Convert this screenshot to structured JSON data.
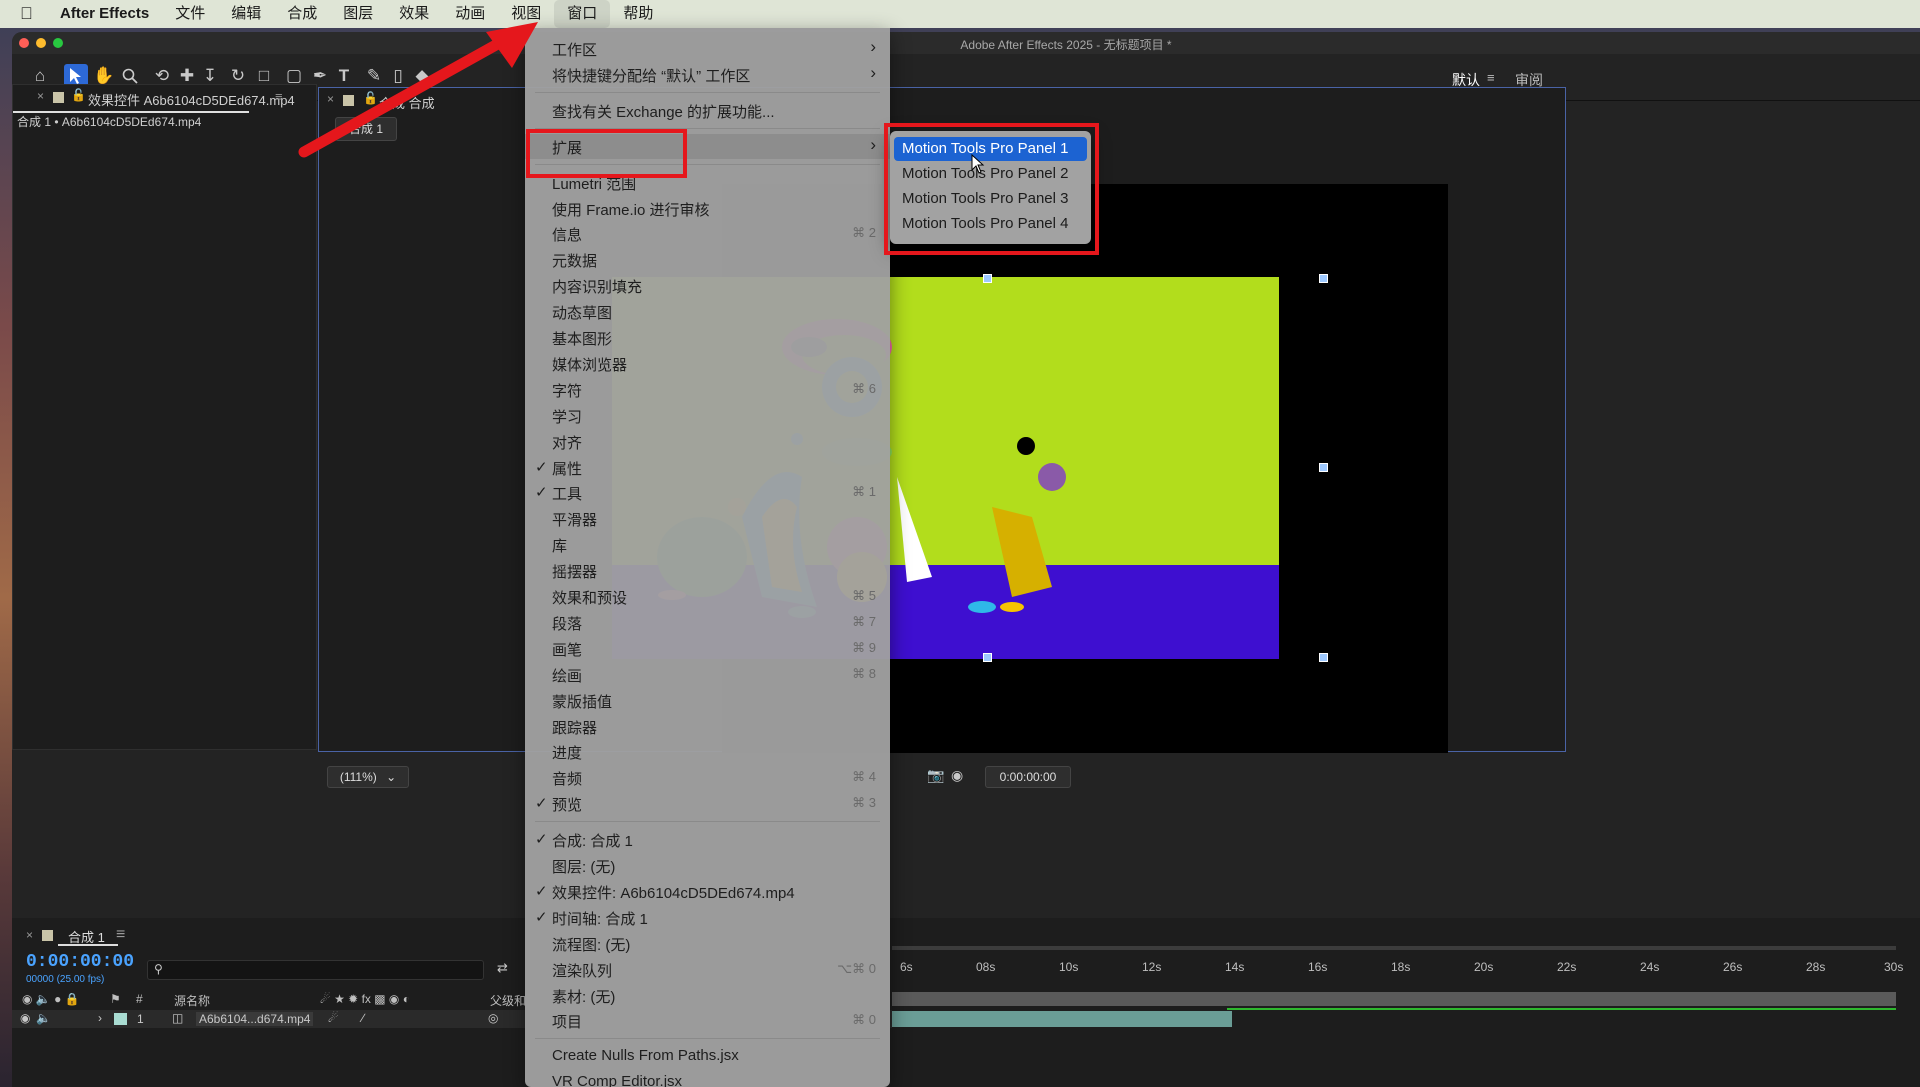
{
  "menubar": {
    "app_name": "After Effects",
    "items": [
      "文件",
      "编辑",
      "合成",
      "图层",
      "效果",
      "动画",
      "视图",
      "窗口",
      "帮助"
    ]
  },
  "window": {
    "title": "Adobe After Effects 2025 - 无标题项目 *"
  },
  "toolbar": {
    "tools": [
      "home-icon",
      "selection-tool-icon",
      "hand-tool-icon",
      "zoom-tool-icon",
      "orbit-camera-icon",
      "pan-camera-icon",
      "dolly-camera-icon",
      "rotate-tool-icon",
      "pan-behind-icon",
      "rectangle-tool-icon",
      "pen-tool-icon",
      "type-tool-icon",
      "brush-tool-icon",
      "clone-stamp-icon",
      "eraser-tool-icon"
    ],
    "workspaces": {
      "current": "默认",
      "other": "审阅"
    }
  },
  "effects_panel": {
    "tab_label": "效果控件 A6b6104cD5DEd674.mp4",
    "breadcrumb": "合成 1 • A6b6104cD5DEd674.mp4"
  },
  "comp_panel": {
    "tab_label": "合成 合成",
    "comp_tab": "合成 1",
    "zoom": "(111%)",
    "timecode": "0:00:00:00"
  },
  "timeline": {
    "tab_label": "合成 1",
    "timecode": "0:00:00:00",
    "fps_label": "00000 (25.00 fps)",
    "col_hash": "#",
    "col_source": "源名称",
    "col_parent": "父级和",
    "layer_index": "1",
    "layer_name": "A6b6104...d674.mp4",
    "ticks": [
      "6s",
      "08s",
      "10s",
      "12s",
      "14s",
      "16s",
      "18s",
      "20s",
      "22s",
      "24s",
      "26s",
      "28s",
      "30s"
    ]
  },
  "window_menu": {
    "items": [
      {
        "label": "工作区",
        "arrow": true
      },
      {
        "label": "将快捷键分配给 “默认” 工作区",
        "arrow": true
      },
      {
        "sep": true
      },
      {
        "label": "查找有关 Exchange 的扩展功能..."
      },
      {
        "sep": true
      },
      {
        "label": "扩展",
        "arrow": true,
        "highlight": true
      },
      {
        "sep": true
      },
      {
        "label": "Lumetri 范围"
      },
      {
        "label": "使用 Frame.io 进行审核"
      },
      {
        "label": "信息",
        "shortcut": "⌘ 2"
      },
      {
        "label": "元数据"
      },
      {
        "label": "内容识别填充"
      },
      {
        "label": "动态草图"
      },
      {
        "label": "基本图形"
      },
      {
        "label": "媒体浏览器"
      },
      {
        "label": "字符",
        "shortcut": "⌘ 6"
      },
      {
        "label": "学习"
      },
      {
        "label": "对齐"
      },
      {
        "label": "属性",
        "checked": true
      },
      {
        "label": "工具",
        "checked": true,
        "shortcut": "⌘ 1"
      },
      {
        "label": "平滑器"
      },
      {
        "label": "库"
      },
      {
        "label": "摇摆器"
      },
      {
        "label": "效果和预设",
        "shortcut": "⌘ 5"
      },
      {
        "label": "段落",
        "shortcut": "⌘ 7"
      },
      {
        "label": "画笔",
        "shortcut": "⌘ 9"
      },
      {
        "label": "绘画",
        "shortcut": "⌘ 8"
      },
      {
        "label": "蒙版插值"
      },
      {
        "label": "跟踪器"
      },
      {
        "label": "进度"
      },
      {
        "label": "音频",
        "shortcut": "⌘ 4"
      },
      {
        "label": "预览",
        "checked": true,
        "shortcut": "⌘ 3"
      },
      {
        "sep": true
      },
      {
        "label": "合成: 合成 1",
        "checked": true
      },
      {
        "label": "图层: (无)"
      },
      {
        "label": "效果控件: A6b6104cD5DEd674.mp4",
        "checked": true
      },
      {
        "label": "时间轴: 合成 1",
        "checked": true
      },
      {
        "label": "流程图: (无)"
      },
      {
        "label": "渲染队列",
        "shortcut": "⌥⌘ 0"
      },
      {
        "label": "素材: (无)"
      },
      {
        "label": "项目",
        "shortcut": "⌘ 0"
      },
      {
        "sep": true
      },
      {
        "label": "Create Nulls From Paths.jsx"
      },
      {
        "label": "VR Comp Editor.jsx"
      }
    ]
  },
  "extension_submenu": {
    "items": [
      "Motion Tools Pro Panel 1",
      "Motion Tools Pro Panel 2",
      "Motion Tools Pro Panel 3",
      "Motion Tools Pro Panel 4"
    ],
    "highlighted_index": 0
  },
  "colors": {
    "annotation_red": "#e5171c",
    "menu_highlight": "#1c63d2",
    "timecode_blue": "#4aa3ff"
  }
}
